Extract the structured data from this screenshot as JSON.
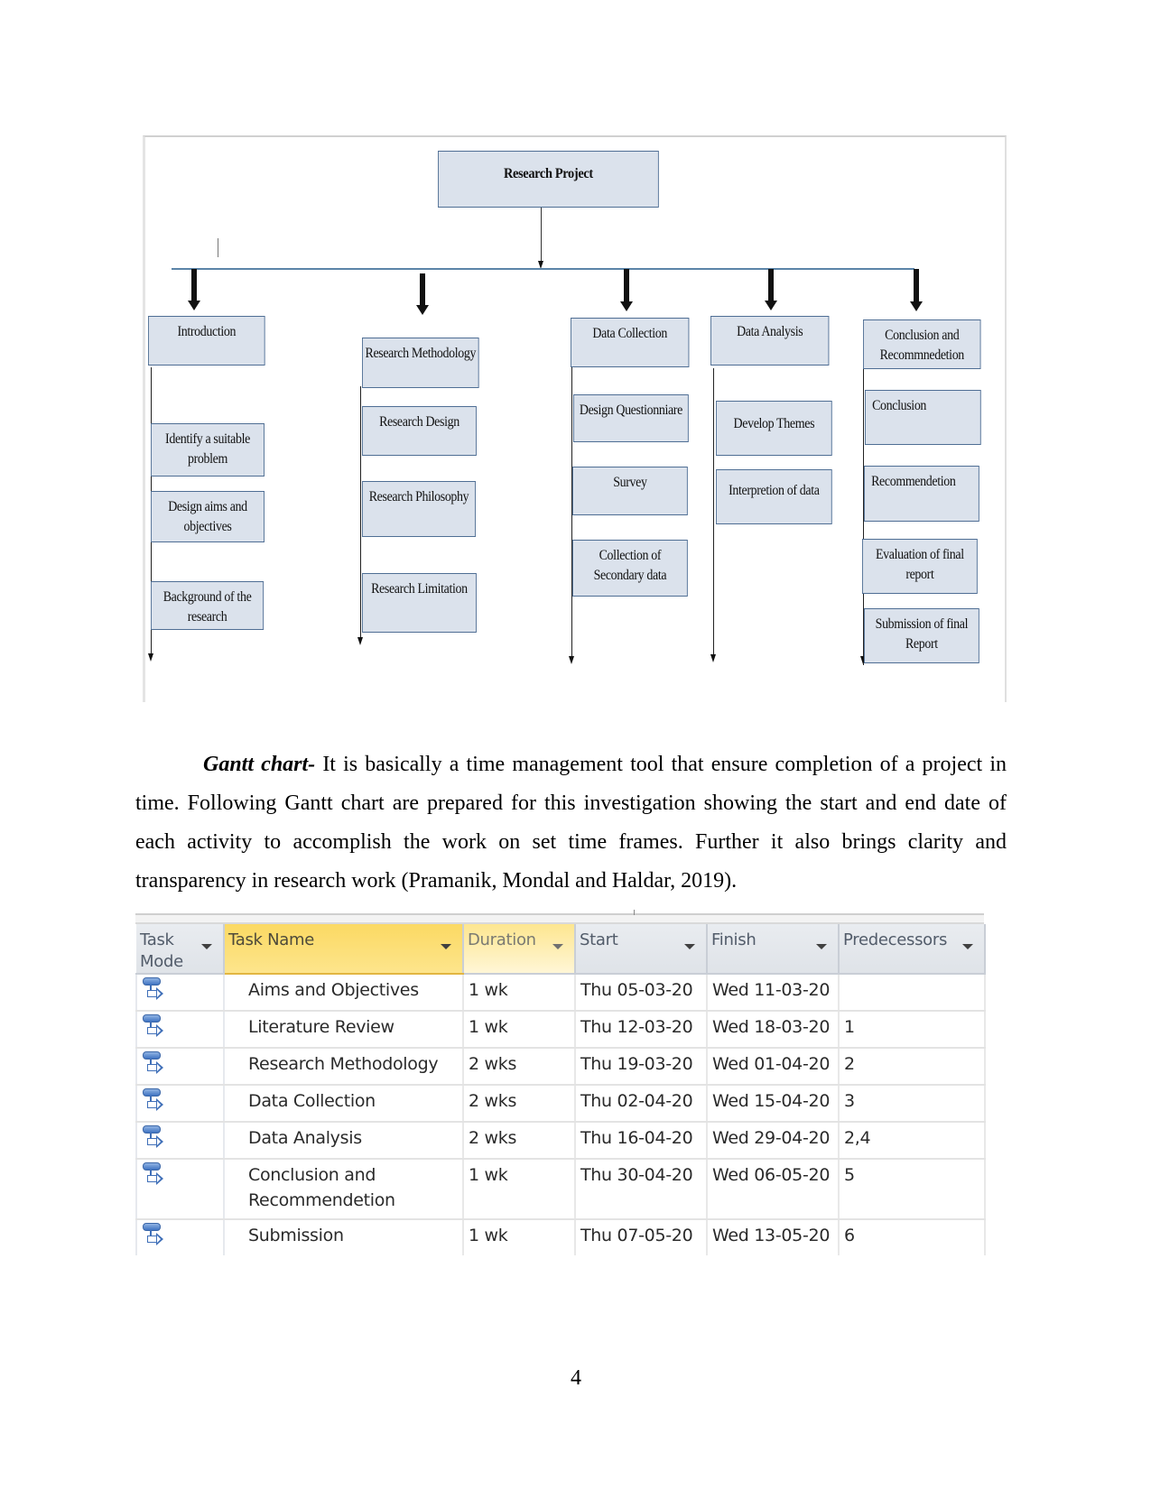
{
  "diagram": {
    "root": "Research Project",
    "branches": [
      {
        "title": "Introduction",
        "children": [
          "Identify a suitable problem",
          "Design aims and objectives",
          "Background of the research"
        ]
      },
      {
        "title": "Research Methodology",
        "children": [
          "Research Design",
          "Research Philosophy",
          "Research Limitation"
        ]
      },
      {
        "title": "Data Collection",
        "children": [
          "Design Questionniare",
          "Survey",
          "Collection of Secondary data"
        ]
      },
      {
        "title": "Data Analysis",
        "children": [
          "Develop Themes",
          "Interpretion of data"
        ]
      },
      {
        "title": "Conclusion and Recommnedetion",
        "children": [
          "Conclusion",
          "Recommendetion",
          "Evaluation of final report",
          "Submission of final Report"
        ]
      }
    ],
    "colors": {
      "box_fill": "#dbe2ec",
      "box_border": "#4f6e94"
    }
  },
  "paragraph": {
    "lead": "Gantt chart-",
    "text": " It is basically a time management tool that ensure completion of a project in time. Following Gantt chart are prepared for this investigation showing the start and end date of each activity to accomplish the work on set time frames. Further it also brings clarity and transparency in research work (Pramanik, Mondal and Haldar, 2019)."
  },
  "gantt": {
    "columns": [
      "Task Mode",
      "Task Name",
      "Duration",
      "Start",
      "Finish",
      "Predecessors"
    ],
    "rows": [
      {
        "mode_icon": "auto-scheduled-task-icon",
        "name": "Aims and Objectives",
        "duration": "1 wk",
        "start": "Thu 05-03-20",
        "finish": "Wed 11-03-20",
        "predecessors": ""
      },
      {
        "mode_icon": "auto-scheduled-task-icon",
        "name": "Literature Review",
        "duration": "1 wk",
        "start": "Thu 12-03-20",
        "finish": "Wed 18-03-20",
        "predecessors": "1"
      },
      {
        "mode_icon": "auto-scheduled-task-icon",
        "name": "Research Methodology",
        "duration": "2 wks",
        "start": "Thu 19-03-20",
        "finish": "Wed 01-04-20",
        "predecessors": "2"
      },
      {
        "mode_icon": "auto-scheduled-task-icon",
        "name": "Data Collection",
        "duration": "2 wks",
        "start": "Thu 02-04-20",
        "finish": "Wed 15-04-20",
        "predecessors": "3"
      },
      {
        "mode_icon": "auto-scheduled-task-icon",
        "name": "Data Analysis",
        "duration": "2 wks",
        "start": "Thu 16-04-20",
        "finish": "Wed 29-04-20",
        "predecessors": "2,4"
      },
      {
        "mode_icon": "auto-scheduled-task-icon",
        "name": "Conclusion and Recommendetion",
        "duration": "1 wk",
        "start": "Thu 30-04-20",
        "finish": "Wed 06-05-20",
        "predecessors": "5"
      },
      {
        "mode_icon": "auto-scheduled-task-icon",
        "name": "Submission",
        "duration": "1 wk",
        "start": "Thu 07-05-20",
        "finish": "Wed 13-05-20",
        "predecessors": "6"
      }
    ],
    "colors": {
      "selected_header": "#fbd963",
      "header": "#e3e7ec"
    }
  },
  "page_number": "4"
}
